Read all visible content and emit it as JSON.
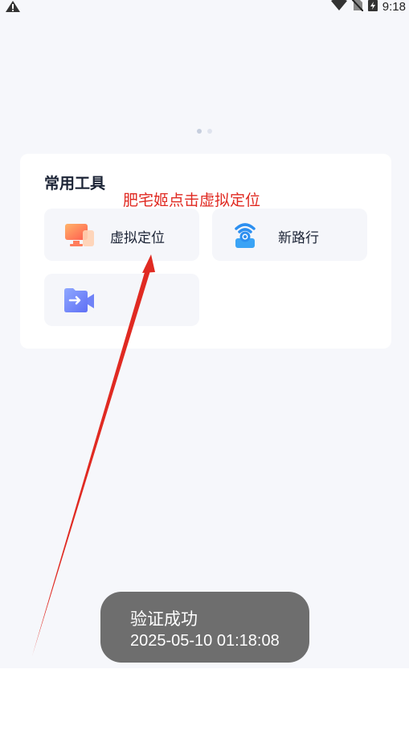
{
  "status_bar": {
    "time": "9:18",
    "icons": [
      "warning-icon",
      "wifi-icon",
      "no-sim-icon",
      "battery-charging-icon"
    ]
  },
  "carousel": {
    "pages": 2,
    "active_index": 0
  },
  "tools": {
    "title": "常用工具",
    "items": [
      {
        "label": "虚拟定位",
        "icon": "virtual-location-monitor-icon"
      },
      {
        "label": "新路行",
        "icon": "wifi-location-icon"
      },
      {
        "label": "",
        "icon": "video-folder-icon"
      }
    ]
  },
  "annotation": {
    "text": "肥宅姬点击虚拟定位",
    "color": "#e02a22"
  },
  "toast": {
    "title": "验证成功",
    "timestamp": "2025-05-10 01:18:08"
  },
  "colors": {
    "background": "#f6f7fb",
    "card": "#ffffff",
    "tile": "#f5f6fa",
    "text": "#1c2436",
    "annotation_red": "#e02a22",
    "toast_bg": "#6e6e6e"
  }
}
